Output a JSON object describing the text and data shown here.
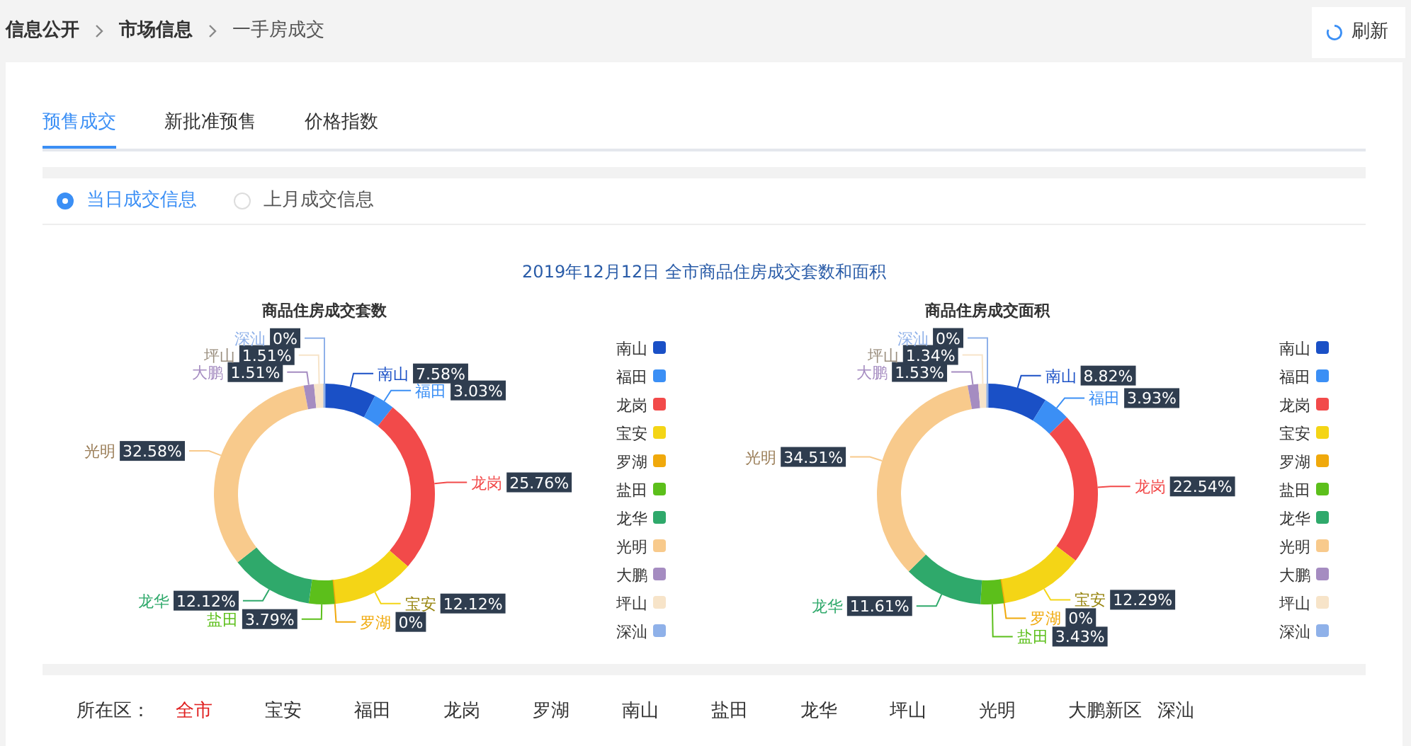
{
  "breadcrumb": [
    {
      "label": "信息公开",
      "current": false
    },
    {
      "label": "市场信息",
      "current": false
    },
    {
      "label": "一手房成交",
      "current": true
    }
  ],
  "refresh_button": {
    "label": "刷新"
  },
  "tabs": [
    {
      "label": "预售成交",
      "selected": true
    },
    {
      "label": "新批准预售",
      "selected": false
    },
    {
      "label": "价格指数",
      "selected": false
    }
  ],
  "radios": [
    {
      "label": "当日成交信息",
      "selected": true
    },
    {
      "label": "上月成交信息",
      "selected": false
    }
  ],
  "report_title": "2019年12月12日 全市商品住房成交套数和面积",
  "charts": [
    {
      "chart_data": {
        "type": "donut",
        "title": "商品住房成交套数",
        "legend": "right",
        "categories": [
          "南山",
          "福田",
          "龙岗",
          "宝安",
          "罗湖",
          "盐田",
          "龙华",
          "光明",
          "大鹏",
          "坪山",
          "深汕"
        ],
        "values": [
          7.58,
          3.03,
          25.76,
          12.12,
          0,
          3.79,
          12.12,
          32.58,
          1.51,
          1.51,
          0
        ],
        "value_labels": [
          "7.58%",
          "3.03%",
          "25.76%",
          "12.12%",
          "0%",
          "3.79%",
          "12.12%",
          "32.58%",
          "1.51%",
          "1.51%",
          "0%"
        ],
        "colors": [
          "#1a50c6",
          "#3b8ff5",
          "#f24a4a",
          "#f4d516",
          "#f0a90c",
          "#5cbf1b",
          "#2fa96b",
          "#f8ca8c",
          "#a58cc1",
          "#f7e4c9",
          "#8fb1e9"
        ]
      }
    },
    {
      "chart_data": {
        "type": "donut",
        "title": "商品住房成交面积",
        "legend": "right",
        "categories": [
          "南山",
          "福田",
          "龙岗",
          "宝安",
          "罗湖",
          "盐田",
          "龙华",
          "光明",
          "大鹏",
          "坪山",
          "深汕"
        ],
        "values": [
          8.82,
          3.93,
          22.54,
          12.29,
          0,
          3.43,
          11.61,
          34.51,
          1.53,
          1.34,
          0
        ],
        "value_labels": [
          "8.82%",
          "3.93%",
          "22.54%",
          "12.29%",
          "0%",
          "3.43%",
          "11.61%",
          "34.51%",
          "1.53%",
          "1.34%",
          "0%"
        ],
        "colors": [
          "#1a50c6",
          "#3b8ff5",
          "#f24a4a",
          "#f4d516",
          "#f0a90c",
          "#5cbf1b",
          "#2fa96b",
          "#f8ca8c",
          "#a58cc1",
          "#f7e4c9",
          "#8fb1e9"
        ]
      }
    }
  ],
  "district_filter": {
    "label": "所在区：",
    "options": [
      {
        "label": "全市",
        "selected": true
      },
      {
        "label": "宝安",
        "selected": false
      },
      {
        "label": "福田",
        "selected": false
      },
      {
        "label": "龙岗",
        "selected": false
      },
      {
        "label": "罗湖",
        "selected": false
      },
      {
        "label": "南山",
        "selected": false
      },
      {
        "label": "盐田",
        "selected": false
      },
      {
        "label": "龙华",
        "selected": false
      },
      {
        "label": "坪山",
        "selected": false
      },
      {
        "label": "光明",
        "selected": false
      },
      {
        "label": "大鹏新区",
        "selected": false
      },
      {
        "label": "深汕",
        "selected": false
      }
    ]
  }
}
